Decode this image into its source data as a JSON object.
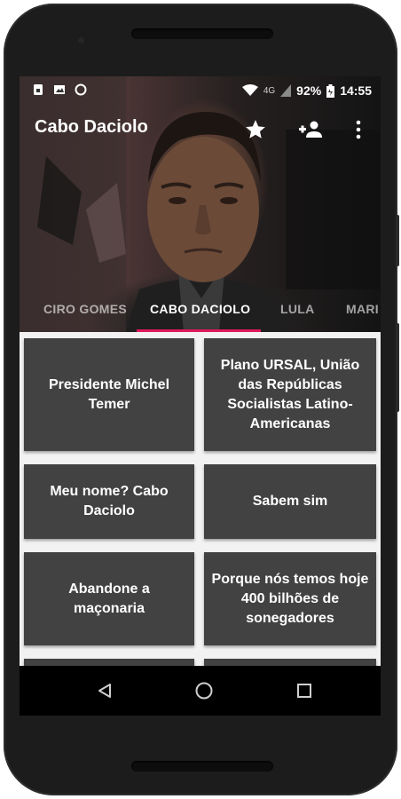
{
  "status_bar": {
    "network": "4G",
    "battery": "92%",
    "time": "14:55",
    "icons": [
      "sim-icon",
      "image-icon",
      "sync-icon",
      "wifi-icon",
      "signal-icon",
      "battery-icon"
    ]
  },
  "toolbar": {
    "title": "Cabo Daciolo",
    "actions": [
      "star-icon",
      "add-person-icon",
      "more-vert-icon"
    ]
  },
  "tabs": [
    {
      "label": "CIRO GOMES",
      "active": false
    },
    {
      "label": "CABO DACIOLO",
      "active": true
    },
    {
      "label": "LULA",
      "active": false
    },
    {
      "label": "MARI",
      "active": false
    }
  ],
  "accent_color": "#e0185c",
  "card_color": "#424242",
  "cards": [
    {
      "label": "Presidente Michel Temer"
    },
    {
      "label": "Plano URSAL, União das Repúblicas Socialistas Latino-Americanas"
    },
    {
      "label": "Meu nome? Cabo Daciolo"
    },
    {
      "label": "Sabem sim"
    },
    {
      "label": "Abandone a maçonaria"
    },
    {
      "label": "Porque nós temos hoje 400 bilhões de sonegadores"
    }
  ],
  "nav_bar": {
    "buttons": [
      "back-icon",
      "home-icon",
      "recents-icon"
    ]
  }
}
